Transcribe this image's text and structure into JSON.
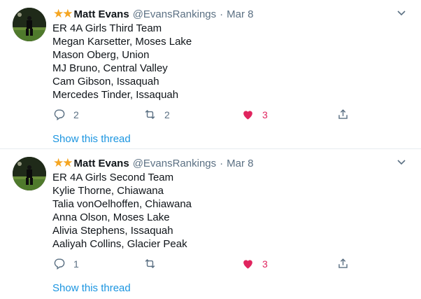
{
  "tweets": [
    {
      "stars": "★★",
      "name": "Matt Evans",
      "handle": "@EvansRankings",
      "separator": "·",
      "date": "Mar 8",
      "lines": [
        "ER 4A Girls Third Team",
        "Megan Karsetter, Moses Lake",
        "Mason Oberg, Union",
        "MJ Bruno, Central Valley",
        "Cam Gibson, Issaquah",
        "Mercedes Tinder, Issaquah"
      ],
      "replies": "2",
      "retweets": "2",
      "likes": "3",
      "liked": true,
      "show_thread": "Show this thread"
    },
    {
      "stars": "★★",
      "name": "Matt Evans",
      "handle": "@EvansRankings",
      "separator": "·",
      "date": "Mar 8",
      "lines": [
        "ER 4A Girls Second Team",
        "Kylie Thorne, Chiawana",
        "Talia vonOelhoffen, Chiawana",
        "Anna Olson, Moses Lake",
        "Alivia Stephens, Issaquah",
        "Aaliyah Collins, Glacier Peak"
      ],
      "replies": "1",
      "retweets": "",
      "likes": "3",
      "liked": true,
      "show_thread": "Show this thread"
    }
  ],
  "icons": {
    "reply": "reply-icon",
    "retweet": "retweet-icon",
    "like": "heart-filled-icon",
    "share": "share-icon",
    "caret": "chevron-down-icon"
  },
  "colors": {
    "star": "#f5a623",
    "like": "#e0245e",
    "link": "#1b95e0",
    "muted": "#5b7083"
  }
}
